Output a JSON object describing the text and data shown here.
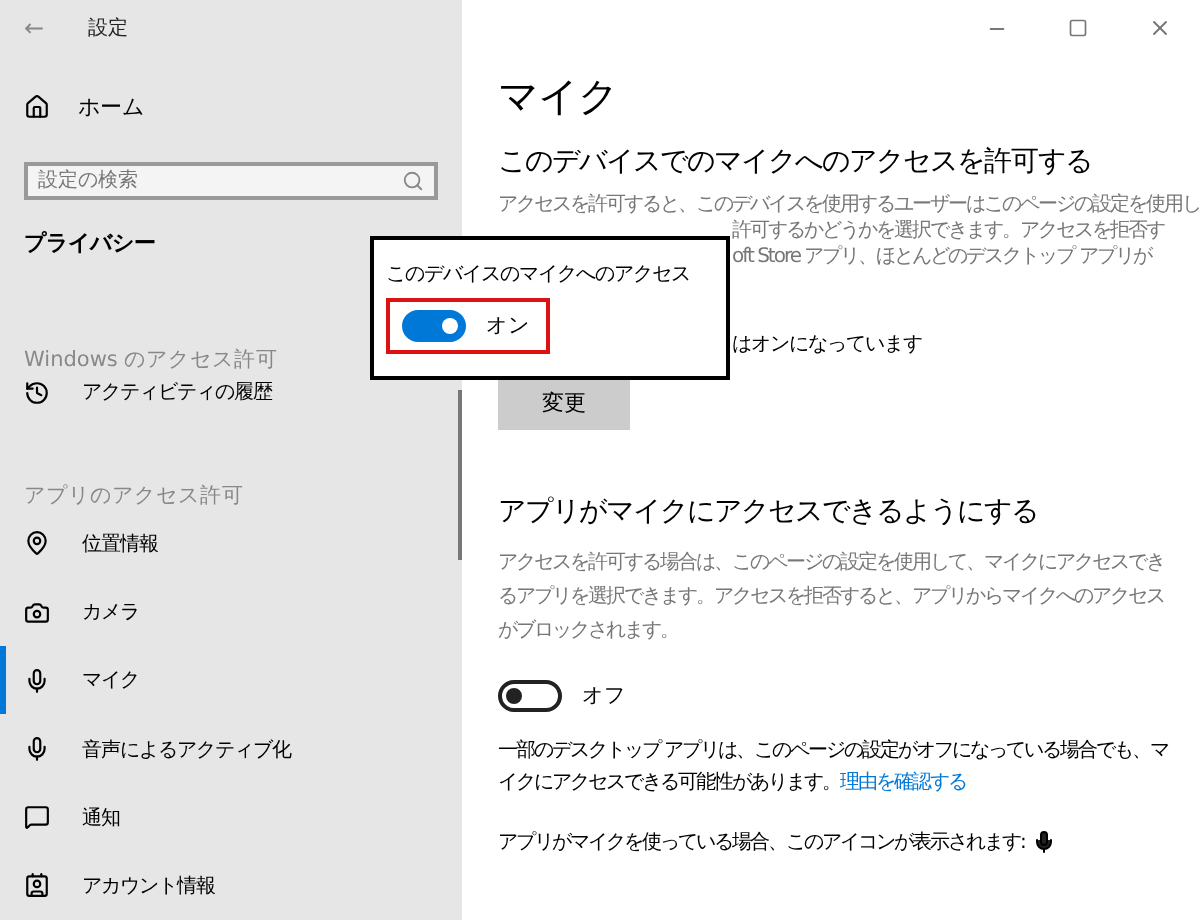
{
  "window": {
    "title": "設定",
    "back": "←"
  },
  "sidebar": {
    "home": "ホーム",
    "search": {
      "placeholder": "設定の検索"
    },
    "category": "プライバシー",
    "groups": [
      {
        "heading": "Windows のアクセス許可",
        "items": [
          {
            "label": "アクティビティの履歴",
            "selected": false
          }
        ]
      },
      {
        "heading": "アプリのアクセス許可",
        "items": [
          {
            "label": "位置情報",
            "selected": false
          },
          {
            "label": "カメラ",
            "selected": false
          },
          {
            "label": "マイク",
            "selected": true
          },
          {
            "label": "音声によるアクティブ化",
            "selected": false
          },
          {
            "label": "通知",
            "selected": false
          },
          {
            "label": "アカウント情報",
            "selected": false
          }
        ]
      }
    ]
  },
  "main": {
    "title": "マイク",
    "device_section": {
      "heading": "このデバイスでのマイクへのアクセスを許可する",
      "lines": [
        {
          "text": "アクセスを許可すると、このデバイスを使用するユーザーはこのページの設定を使用し",
          "covered": false
        },
        {
          "text": "許可するかどうかを選択できます。アクセスを拒否す",
          "covered": true
        },
        {
          "text": "oft Store アプリ、ほとんどのデスクトップ アプリが",
          "covered": true
        }
      ],
      "status": "はオンになっています",
      "button": "変更"
    },
    "apps_section": {
      "heading": "アプリがマイクにアクセスできるようにする",
      "description": "アクセスを許可する場合は、このページの設定を使用して、マイクにアクセスできるアプリを選択できます。アクセスを拒否すると、アプリからマイクへのアクセスがブロックされます。",
      "toggle": {
        "on": false,
        "label": "オフ"
      },
      "note": "一部のデスクトップ アプリは、このページの設定がオフになっている場合でも、マイクにアクセスできる可能性があります。",
      "link": "理由を確認する",
      "icon_note": "アプリがマイクを使っている場合、このアイコンが表示されます:"
    }
  },
  "popup": {
    "title": "このデバイスのマイクへのアクセス",
    "toggle": {
      "on": true,
      "label": "オン"
    }
  }
}
